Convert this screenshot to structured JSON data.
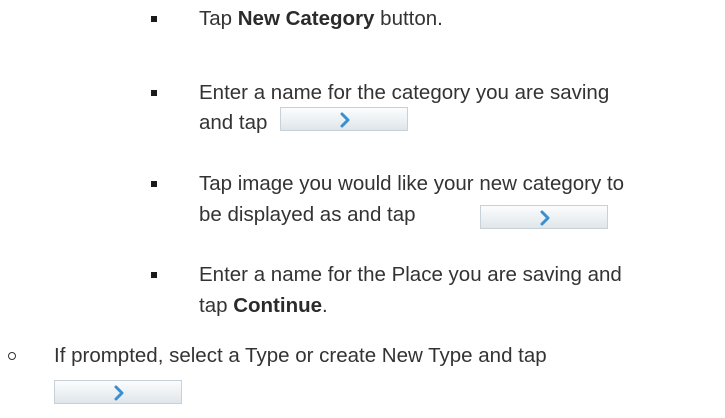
{
  "steps": [
    {
      "pre": "Tap ",
      "bold": "New Category",
      "post": " button."
    },
    {
      "line1": "Enter a name for the category you are saving",
      "line2_pre": "and tap"
    },
    {
      "line1": "Tap image you would like your new category to",
      "line2_pre": "be displayed as and tap"
    },
    {
      "line1": "Enter a name for the Place you are saving and",
      "line2_pre": "tap ",
      "line2_bold": "Continue",
      "line2_post": "."
    }
  ],
  "sub_step": {
    "line1": "If prompted, select a Type or create New Type and tap"
  },
  "continue_button": {
    "icon": "chevron-right-icon",
    "color_top": "#fbfcfd",
    "color_bottom": "#dfe5ea",
    "chevron_color": "#3a8fd0"
  }
}
